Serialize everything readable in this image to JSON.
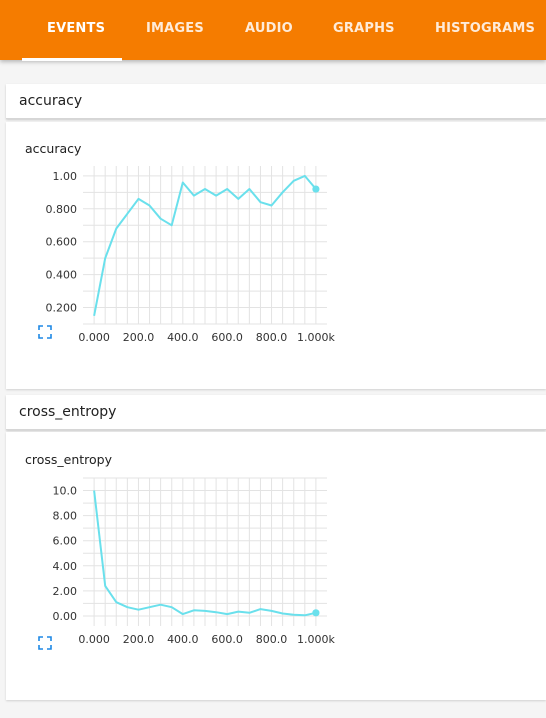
{
  "tabs": [
    {
      "label": "EVENTS",
      "active": true
    },
    {
      "label": "IMAGES",
      "active": false
    },
    {
      "label": "AUDIO",
      "active": false
    },
    {
      "label": "GRAPHS",
      "active": false
    },
    {
      "label": "HISTOGRAMS",
      "active": false
    }
  ],
  "colors": {
    "topbar": "#f57c00",
    "line": "#6ae0ec",
    "expand_icon": "#1e88e5"
  },
  "cards": [
    {
      "header": "accuracy"
    },
    {
      "header": "cross_entropy"
    }
  ],
  "icons": {
    "expand": "fullscreen-expand-icon"
  },
  "chart_data": [
    {
      "type": "line",
      "title": "accuracy",
      "xlabel": "",
      "ylabel": "",
      "x_ticks": [
        "0.000",
        "200.0",
        "400.0",
        "600.0",
        "800.0",
        "1.000k"
      ],
      "y_ticks": [
        "0.200",
        "0.400",
        "0.600",
        "0.800",
        "1.00"
      ],
      "xlim": [
        -50,
        1050
      ],
      "ylim": [
        0.1,
        1.06
      ],
      "grid": true,
      "x": [
        0,
        50,
        100,
        150,
        200,
        250,
        300,
        350,
        400,
        450,
        500,
        550,
        600,
        650,
        700,
        750,
        800,
        850,
        900,
        950,
        1000
      ],
      "y": [
        0.15,
        0.5,
        0.68,
        0.77,
        0.86,
        0.82,
        0.74,
        0.7,
        0.96,
        0.88,
        0.92,
        0.88,
        0.92,
        0.86,
        0.92,
        0.84,
        0.82,
        0.9,
        0.97,
        1.0,
        0.92
      ],
      "last_point_marker": true
    },
    {
      "type": "line",
      "title": "cross_entropy",
      "xlabel": "",
      "ylabel": "",
      "x_ticks": [
        "0.000",
        "200.0",
        "400.0",
        "600.0",
        "800.0",
        "1.000k"
      ],
      "y_ticks": [
        "0.00",
        "2.00",
        "4.00",
        "6.00",
        "8.00",
        "10.0"
      ],
      "xlim": [
        -50,
        1050
      ],
      "ylim": [
        -0.8,
        11
      ],
      "grid": true,
      "x": [
        0,
        50,
        100,
        150,
        200,
        250,
        300,
        350,
        400,
        450,
        500,
        550,
        600,
        650,
        700,
        750,
        800,
        850,
        900,
        950,
        1000
      ],
      "y": [
        10.0,
        2.4,
        1.1,
        0.7,
        0.5,
        0.7,
        0.9,
        0.7,
        0.15,
        0.45,
        0.4,
        0.3,
        0.15,
        0.35,
        0.25,
        0.55,
        0.4,
        0.2,
        0.1,
        0.05,
        0.25
      ],
      "last_point_marker": true
    }
  ]
}
